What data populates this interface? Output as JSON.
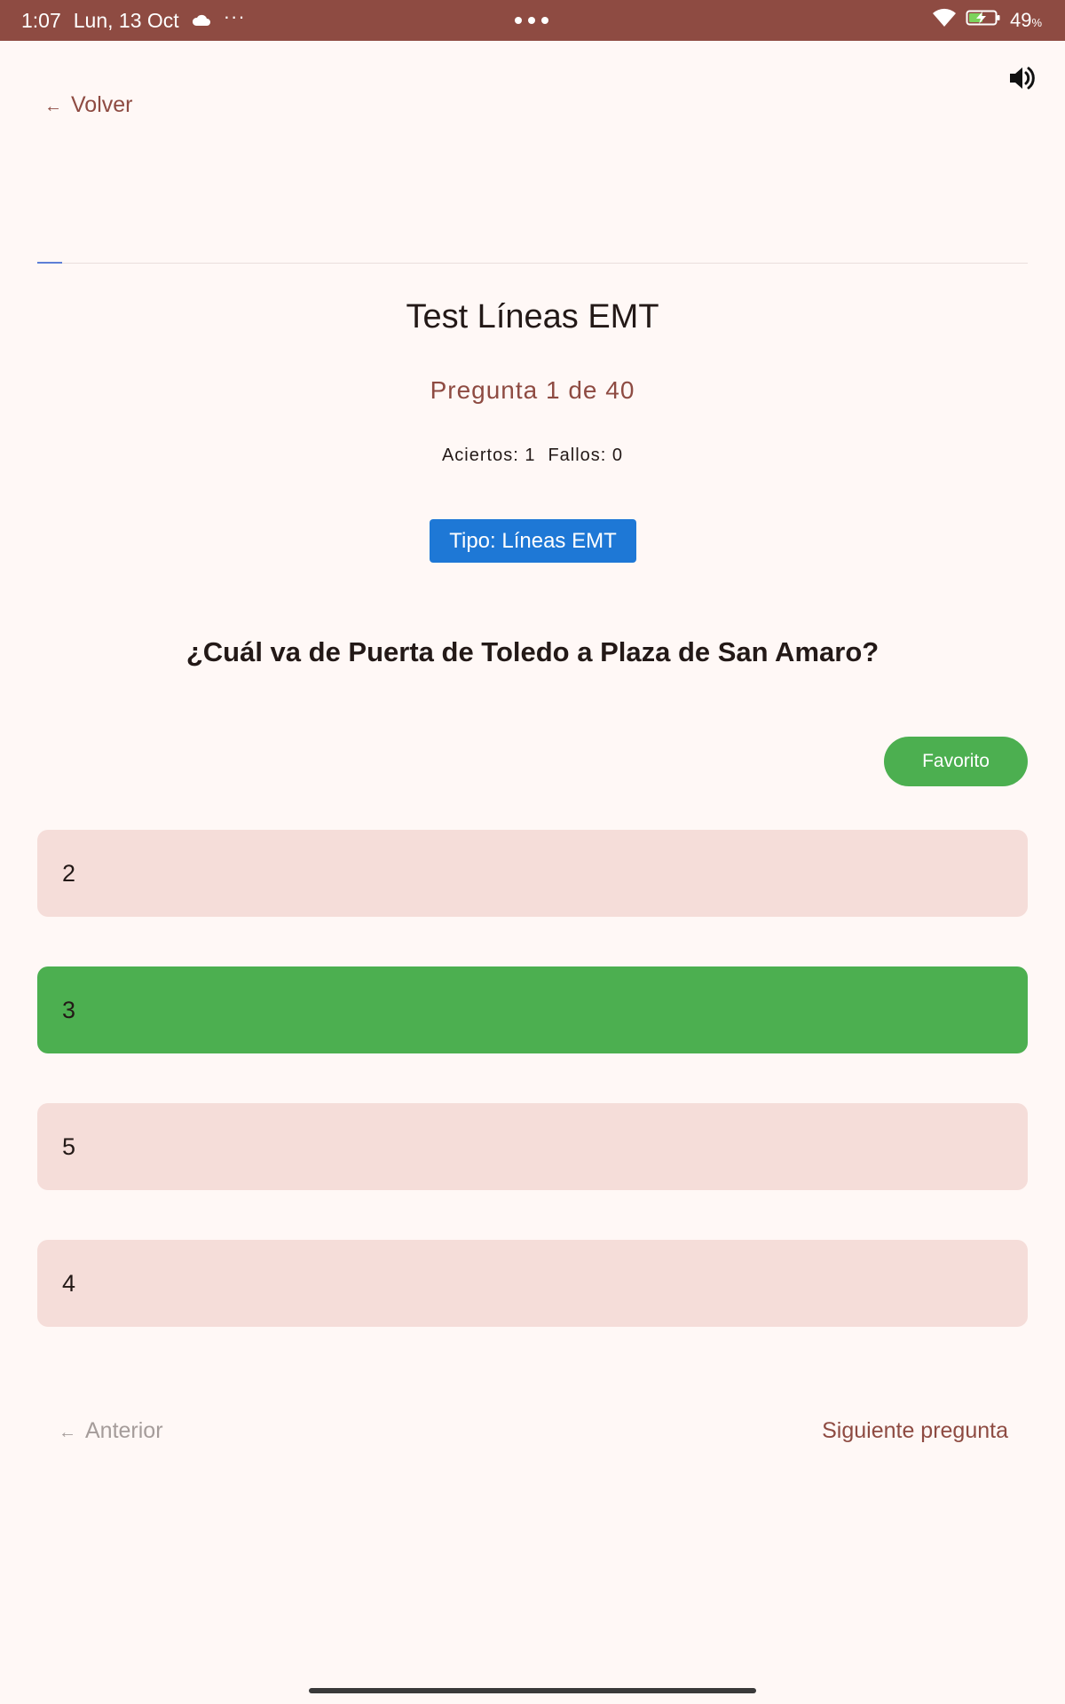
{
  "status_bar": {
    "time": "1:07",
    "date": "Lun, 13 Oct",
    "more": "···",
    "battery_percent": "49",
    "battery_unit": "%"
  },
  "header": {
    "back_label": "Volver",
    "back_arrow": "←"
  },
  "quiz": {
    "title": "Test Líneas EMT",
    "progress_text": "Pregunta 1 de 40",
    "progress_fraction": 0.025,
    "correct_label": "Aciertos: 1",
    "wrong_label": "Fallos: 0",
    "type_label": "Tipo: Líneas EMT",
    "question": "¿Cuál va de Puerta de Toledo a Plaza de San Amaro?",
    "favorite_label": "Favorito",
    "options": [
      {
        "label": "2",
        "state": "default"
      },
      {
        "label": "3",
        "state": "correct"
      },
      {
        "label": "5",
        "state": "default"
      },
      {
        "label": "4",
        "state": "default"
      }
    ]
  },
  "navigation": {
    "prev_arrow": "←",
    "prev_label": "Anterior",
    "next_label": "Siguiente pregunta"
  },
  "colors": {
    "status_bar": "#8e4b42",
    "accent": "#8e4b42",
    "badge": "#1e78d6",
    "correct": "#4caf50",
    "option_bg": "#f5ddd9",
    "background": "#fff8f6"
  },
  "icons": {
    "cloud": "cloud-icon",
    "wifi": "wifi-icon",
    "battery": "battery-charging-icon",
    "speaker": "speaker-icon"
  }
}
